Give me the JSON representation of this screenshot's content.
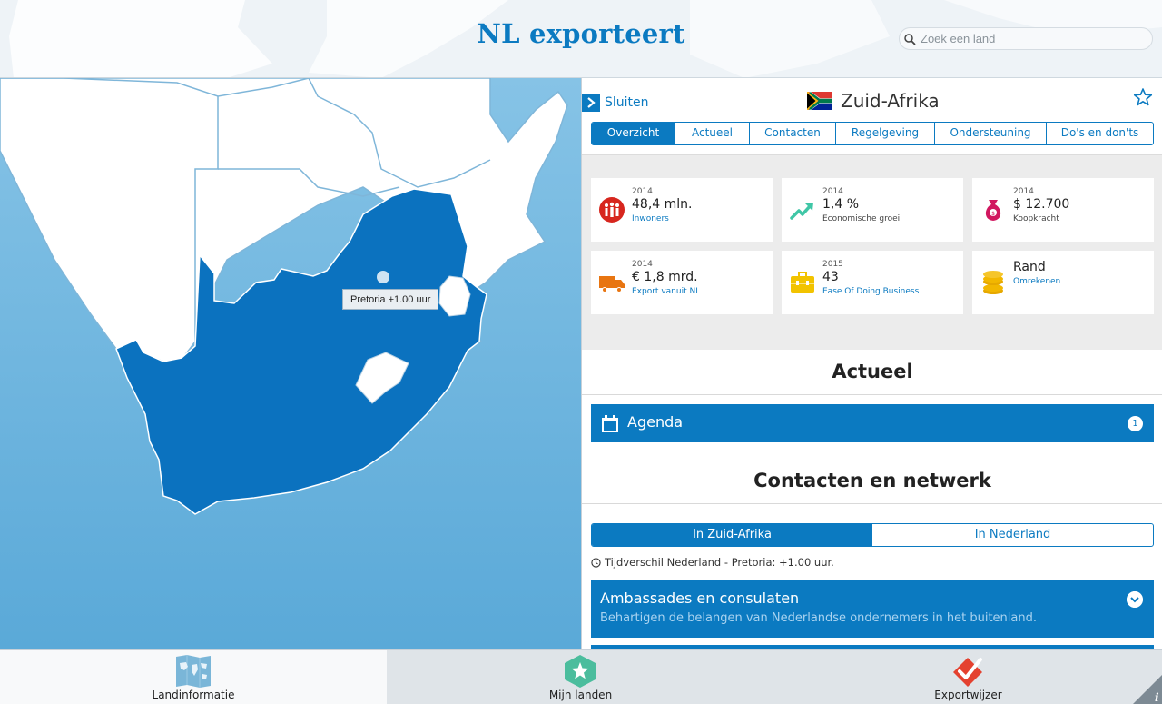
{
  "header": {
    "title": "NL exporteert",
    "search_placeholder": "Zoek een land",
    "search_value": ""
  },
  "map": {
    "pin_label": "Pretoria +1.00 uur"
  },
  "panel": {
    "close_label": "Sluiten",
    "country_name": "Zuid-Afrika",
    "tabs": [
      {
        "label": "Overzicht",
        "active": true
      },
      {
        "label": "Actueel",
        "active": false
      },
      {
        "label": "Contacten",
        "active": false
      },
      {
        "label": "Regelgeving",
        "active": false
      },
      {
        "label": "Ondersteuning",
        "active": false
      },
      {
        "label": "Do's en don'ts",
        "active": false
      }
    ],
    "cards": [
      {
        "year": "2014",
        "value": "48,4 mln.",
        "label": "Inwoners",
        "link": true,
        "icon": "people-icon"
      },
      {
        "year": "2014",
        "value": "1,4 %",
        "label": "Economische groei",
        "link": false,
        "icon": "growth-arrow-icon"
      },
      {
        "year": "2014",
        "value": "$ 12.700",
        "label": "Koopkracht",
        "link": false,
        "icon": "money-bag-icon"
      },
      {
        "year": "2014",
        "value": "€ 1,8 mrd.",
        "label": "Export vanuit NL",
        "link": true,
        "icon": "truck-icon"
      },
      {
        "year": "2015",
        "value": "43",
        "label": "Ease Of Doing Business",
        "link": true,
        "icon": "briefcase-icon"
      },
      {
        "year": "",
        "value": "Rand",
        "label": "Omrekenen",
        "link": true,
        "icon": "coins-icon"
      }
    ],
    "actueel": {
      "heading": "Actueel",
      "agenda_label": "Agenda",
      "agenda_count": "1"
    },
    "contacten": {
      "heading": "Contacten en netwerk",
      "toggle": [
        {
          "label": "In Zuid-Afrika",
          "active": true
        },
        {
          "label": "In Nederland",
          "active": false
        }
      ],
      "timediff": "Tijdverschil Nederland - Pretoria: +1.00 uur.",
      "embassy_title": "Ambassades en consulaten",
      "embassy_subtitle": "Behartigen de belangen van Nederlandse ondernemers in het buitenland."
    }
  },
  "bottom_nav": {
    "items": [
      {
        "label": "Landinformatie",
        "icon": "world-map-icon"
      },
      {
        "label": "Mijn landen",
        "icon": "star-shield-icon"
      },
      {
        "label": "Exportwijzer",
        "icon": "checkmark-icon"
      }
    ]
  },
  "colors": {
    "accent": "#0b7ac1",
    "ocean_top": "#86c3e6",
    "ocean_bottom": "#5aa9d8",
    "coin": "#f2b700",
    "people": "#d7261e",
    "growth": "#3fc6a6",
    "money": "#d1175f",
    "truck": "#e87511"
  }
}
